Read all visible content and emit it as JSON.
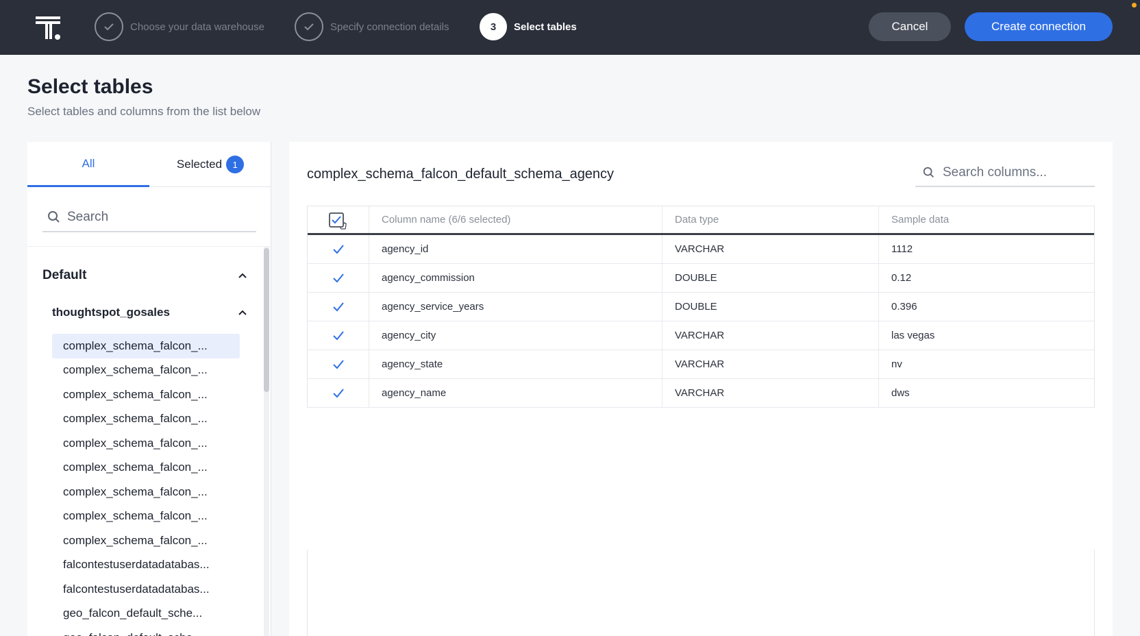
{
  "header": {
    "steps": [
      {
        "number": "",
        "label": "Choose your data warehouse",
        "state": "done"
      },
      {
        "number": "",
        "label": "Specify connection details",
        "state": "done"
      },
      {
        "number": "3",
        "label": "Select tables",
        "state": "active"
      }
    ],
    "cancel_label": "Cancel",
    "create_label": "Create connection"
  },
  "page": {
    "title": "Select tables",
    "subtitle": "Select tables and columns from the list below"
  },
  "left": {
    "tab_all": "All",
    "tab_selected": "Selected",
    "selected_count": "1",
    "search_placeholder": "Search",
    "group_label": "Default",
    "schema_label": "thoughtspot_gosales",
    "tables": [
      "complex_schema_falcon_...",
      "complex_schema_falcon_...",
      "complex_schema_falcon_...",
      "complex_schema_falcon_...",
      "complex_schema_falcon_...",
      "complex_schema_falcon_...",
      "complex_schema_falcon_...",
      "complex_schema_falcon_...",
      "complex_schema_falcon_...",
      "falcontestuserdatadatabas...",
      "falcontestuserdatadatabas...",
      "geo_falcon_default_sche...",
      "geo_falcon_default_sche..."
    ]
  },
  "right": {
    "table_title": "complex_schema_falcon_default_schema_agency",
    "search_placeholder": "Search columns...",
    "headers": {
      "name": "Column name (6/6 selected)",
      "type": "Data type",
      "sample": "Sample data"
    },
    "rows": [
      {
        "name": "agency_id",
        "type": "VARCHAR",
        "sample": "1112"
      },
      {
        "name": "agency_commission",
        "type": "DOUBLE",
        "sample": "0.12"
      },
      {
        "name": "agency_service_years",
        "type": "DOUBLE",
        "sample": "0.396"
      },
      {
        "name": "agency_city",
        "type": "VARCHAR",
        "sample": "las vegas"
      },
      {
        "name": "agency_state",
        "type": "VARCHAR",
        "sample": "nv"
      },
      {
        "name": "agency_name",
        "type": "VARCHAR",
        "sample": "dws"
      }
    ]
  },
  "colors": {
    "accent": "#2f6fe4",
    "topbar": "#2a2f3a"
  }
}
